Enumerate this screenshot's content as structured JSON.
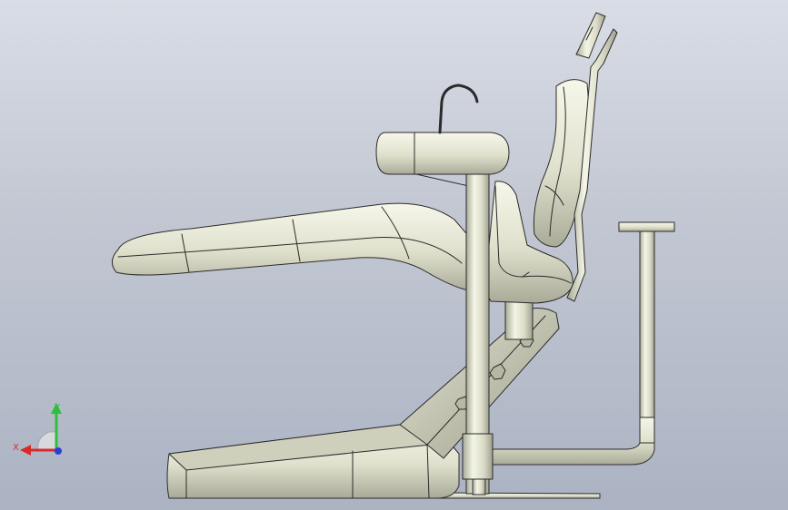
{
  "viewport": {
    "background_top": "#d9dde6",
    "background_bottom": "#abb3c3"
  },
  "model": {
    "name": "dental-chair-assembly",
    "body_color": "#e8e9d8",
    "edge_color": "#2b2b2b"
  },
  "triad": {
    "x_label": "X",
    "y_label": "Y",
    "x_color": "#d92a2a",
    "y_color": "#2fbf3a",
    "z_color": "#2a3fd9"
  }
}
